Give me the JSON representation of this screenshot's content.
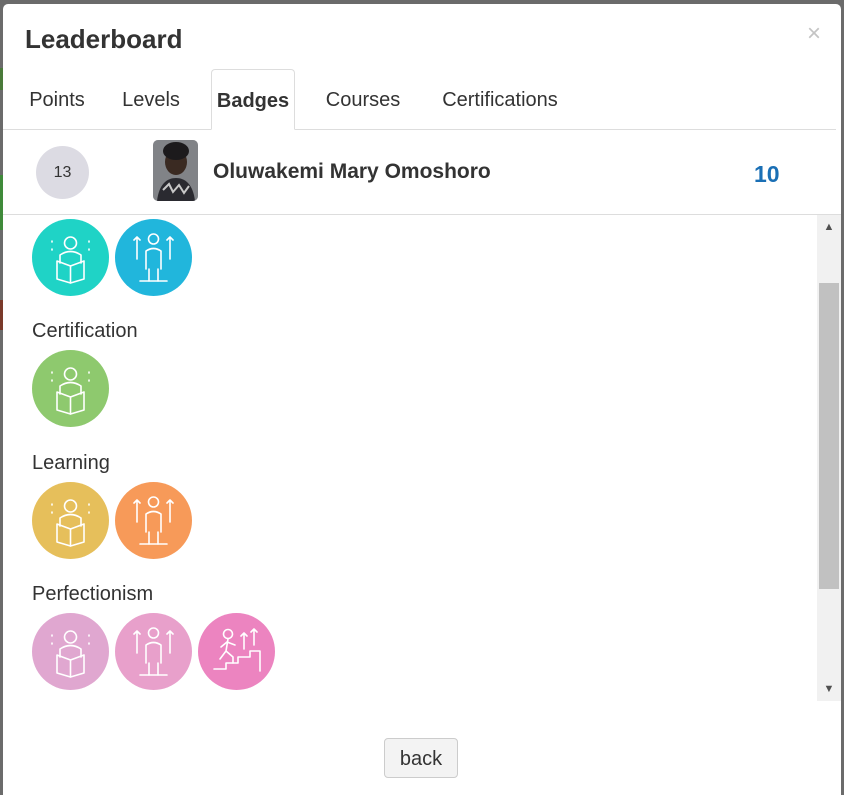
{
  "modal": {
    "title": "Leaderboard",
    "close_label": "×"
  },
  "tabs": [
    {
      "label": "Points"
    },
    {
      "label": "Levels"
    },
    {
      "label": "Badges",
      "active": true
    },
    {
      "label": "Courses"
    },
    {
      "label": "Certifications"
    }
  ],
  "user": {
    "rank": "13",
    "name": "Oluwakemi Mary Omoshoro",
    "score": "10"
  },
  "badge_sections": [
    {
      "label": "",
      "badges": [
        {
          "icon": "reading-person-icon",
          "color": "#1fd3c6"
        },
        {
          "icon": "growth-person-icon",
          "color": "#21b6dc"
        }
      ]
    },
    {
      "label": "Certification",
      "badges": [
        {
          "icon": "reading-person-icon",
          "color": "#8ec96e"
        }
      ]
    },
    {
      "label": "Learning",
      "badges": [
        {
          "icon": "reading-person-icon",
          "color": "#e6bf5b"
        },
        {
          "icon": "growth-person-icon",
          "color": "#f79a59"
        }
      ]
    },
    {
      "label": "Perfectionism",
      "badges": [
        {
          "icon": "reading-person-icon",
          "color": "#e0a7d0"
        },
        {
          "icon": "growth-person-icon",
          "color": "#e8a0cb"
        },
        {
          "icon": "climbing-stairs-icon",
          "color": "#ec84c0"
        }
      ]
    }
  ],
  "footer": {
    "back_label": "back"
  }
}
